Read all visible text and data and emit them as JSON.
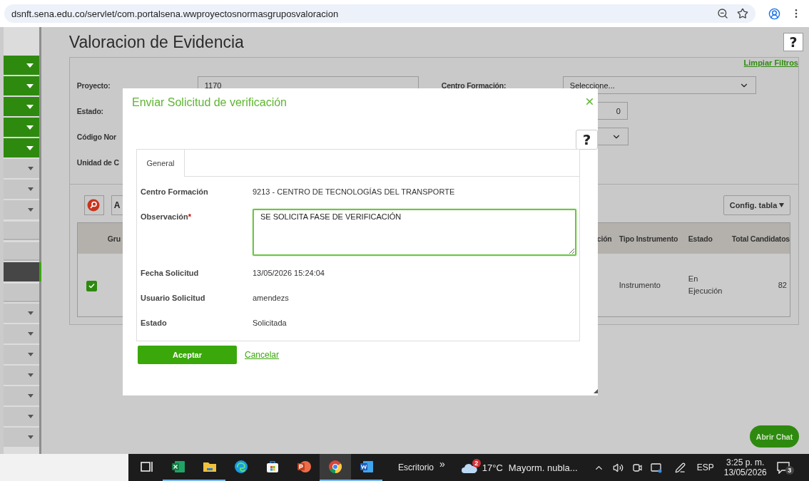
{
  "browser": {
    "url": "dsnft.sena.edu.co/servlet/com.portalsena.wwproyectosnormasgruposvaloracion"
  },
  "sidebar": {
    "items": [
      {
        "kind": "module",
        "selected": false
      },
      {
        "kind": "module",
        "selected": false
      },
      {
        "kind": "module",
        "selected": false
      },
      {
        "kind": "module",
        "selected": false
      },
      {
        "kind": "module",
        "selected": false
      },
      {
        "kind": "submenu",
        "selected": false
      },
      {
        "kind": "submenu",
        "selected": false
      },
      {
        "kind": "submenu",
        "selected": false
      },
      {
        "kind": "link",
        "selected": false
      },
      {
        "kind": "link",
        "selected": false
      },
      {
        "kind": "link",
        "selected": true
      },
      {
        "kind": "link",
        "selected": false
      },
      {
        "kind": "submenu",
        "selected": false
      },
      {
        "kind": "submenu",
        "selected": false
      },
      {
        "kind": "submenu",
        "selected": false
      },
      {
        "kind": "submenu",
        "selected": false
      },
      {
        "kind": "submenu",
        "selected": false
      },
      {
        "kind": "submenu",
        "selected": false
      },
      {
        "kind": "submenu",
        "selected": false
      }
    ]
  },
  "page": {
    "title": "Valoracion de Evidencia",
    "help": "?",
    "clear_filters": "Limpiar Filtros",
    "filters": {
      "project_label": "Proyecto:",
      "project_value": "1170",
      "center_label": "Centro Formación:",
      "center_value": "Seleccione...",
      "status_label": "Estado:",
      "number_value": "0",
      "code_label": "Código Nor",
      "unit_label": "Unidad de C"
    },
    "toolbar": {
      "button_label": "A",
      "config_label": "Config. tabla"
    },
    "table": {
      "columns": [
        "Gru",
        "ción",
        "Tipo Instrumento",
        "Estado",
        "Total Candidatos"
      ],
      "rows": [
        {
          "checked": true,
          "tipo": "Instrumento",
          "estado": "En Ejecución",
          "total": "82"
        }
      ]
    },
    "chat_button": "Abrir Chat"
  },
  "dialog": {
    "title": "Enviar Solicitud de verificación",
    "help": "?",
    "tabs": [
      {
        "label": "General",
        "selected": true
      }
    ],
    "fields": [
      {
        "kind": "text",
        "label": "Centro Formación",
        "value": "9213 - CENTRO DE TECNOLOGÍAS DEL TRANSPORTE"
      },
      {
        "kind": "textarea",
        "label": "Observación",
        "required_mark": "*",
        "value": "SE SOLICITA FASE DE VERIFICACIÓN"
      },
      {
        "kind": "text",
        "label": "Fecha Solicitud",
        "value": "13/05/2026 15:24:04"
      },
      {
        "kind": "text",
        "label": "Usuario Solicitud",
        "value": "amendezs"
      },
      {
        "kind": "text",
        "label": "Estado",
        "value": "Solicitada"
      }
    ],
    "accept": "Aceptar",
    "cancel": "Cancelar"
  },
  "taskbar": {
    "apps": [
      {
        "kind": "taskview",
        "running": false,
        "selected": false
      },
      {
        "kind": "sheets",
        "running": true,
        "selected": false
      },
      {
        "kind": "folder",
        "running": true,
        "selected": false
      },
      {
        "kind": "edge",
        "running": false,
        "selected": false
      },
      {
        "kind": "store",
        "running": false,
        "selected": false
      },
      {
        "kind": "slides",
        "running": false,
        "selected": false
      },
      {
        "kind": "chrome",
        "running": true,
        "selected": true
      },
      {
        "kind": "docs",
        "running": true,
        "selected": false
      }
    ],
    "desktop_label": "Escritorio",
    "overflow": "»",
    "weather": {
      "badge": "2",
      "temperature": "17°C",
      "text": "Mayorm. nubla..."
    },
    "language": "ESP",
    "time": "3:25 p. m.",
    "date": "13/05/2026",
    "notifications": "3"
  }
}
